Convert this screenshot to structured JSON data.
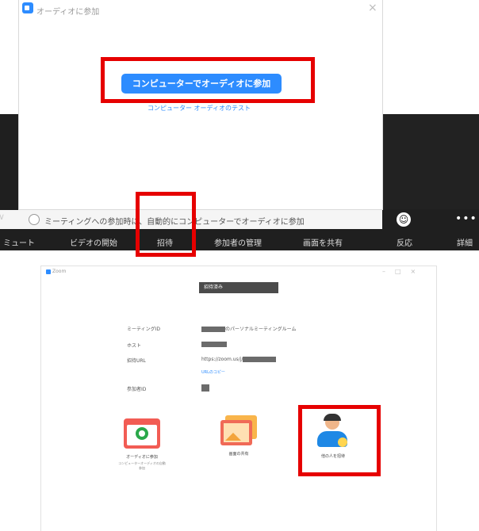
{
  "audio_dialog": {
    "title": "オーディオに参加",
    "close_symbol": "×",
    "join_button": "コンピューターでオーディオに参加",
    "test_link": "コンピューター オーディオのテスト",
    "auto_join_label": "ミーティングへの参加時に、自動的にコンピューターでオーディオに参加"
  },
  "toolbar": {
    "mute": "ミュート",
    "start_video": "ビデオの開始",
    "invite": "招待",
    "manage_participants": "参加者の管理",
    "share_screen": "画面を共有",
    "reactions": "反応",
    "more": "詳細",
    "more_symbol": "•••",
    "reaction_symbol": "☺"
  },
  "room_window": {
    "title": "Zoom",
    "header": "招待済み",
    "rows": [
      {
        "label": "ミーティングID",
        "value": "のパーソナルミーティングルーム"
      },
      {
        "label": "ホスト",
        "value": ""
      },
      {
        "label": "招待URL",
        "value": "https://zoom.us/j/"
      },
      {
        "label": "",
        "value": "URLのコピー"
      },
      {
        "label": "参加者ID",
        "value": ""
      }
    ],
    "tiles": [
      {
        "name": "join-audio",
        "label": "オーディオに参加",
        "sub": "コンピューターオーディオの自動参加"
      },
      {
        "name": "share-screen",
        "label": "画面の共有",
        "sub": ""
      },
      {
        "name": "invite-others",
        "label": "他の人を招待",
        "sub": ""
      }
    ]
  },
  "colors": {
    "zoom_blue": "#2d8cff",
    "highlight_red": "#e60000",
    "toolbar_dark": "#1f1f1f"
  }
}
